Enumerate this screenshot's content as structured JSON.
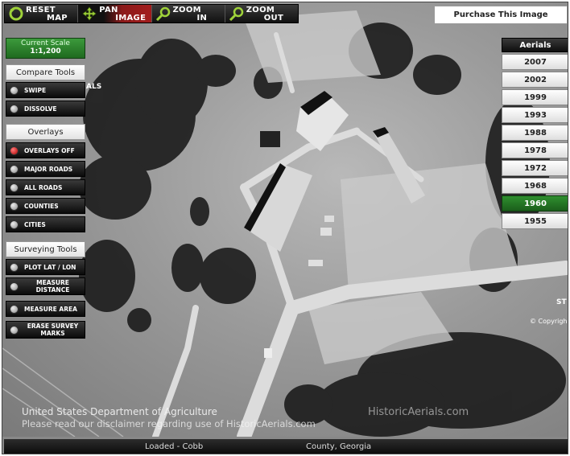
{
  "toolbar": {
    "reset": {
      "line1": "RESET",
      "line2": "MAP",
      "icon": "reset-arrow-icon"
    },
    "pan": {
      "line1": "PAN",
      "line2": "IMAGE",
      "icon": "pan-arrows-icon"
    },
    "zoom_in": {
      "line1": "ZOOM",
      "line2": "IN",
      "icon": "zoom-in-magnifier-icon"
    },
    "zoom_out": {
      "line1": "ZOOM",
      "line2": "OUT",
      "icon": "zoom-out-magnifier-icon"
    }
  },
  "purchase_label": "Purchase This Image",
  "scale": {
    "title": "Current Scale",
    "value": "1:1,200"
  },
  "compare": {
    "title": "Compare Tools",
    "items": [
      "SWIPE",
      "DISSOLVE"
    ]
  },
  "overlays": {
    "title": "Overlays",
    "items": [
      "OVERLAYS OFF",
      "MAJOR ROADS",
      "ALL ROADS",
      "COUNTIES",
      "CITIES"
    ]
  },
  "surveying": {
    "title": "Surveying Tools",
    "items": [
      "PLOT LAT / LON",
      "MEASURE DISTANCE",
      "MEASURE AREA",
      "ERASE SURVEY MARKS"
    ]
  },
  "aerials": {
    "title": "Aerials",
    "years": [
      "2007",
      "2002",
      "1999",
      "1993",
      "1988",
      "1978",
      "1972",
      "1968",
      "1960",
      "1955"
    ],
    "selected": "1960"
  },
  "map": {
    "agency": "United States Department of Agriculture",
    "disclaimer": "Please read our disclaimer regarding use of HistoricAerials.com",
    "watermark": "HistoricAerials.com",
    "copyright": "© Copyrigh",
    "edge_left": "ALS",
    "edge_right": "ST"
  },
  "status": {
    "loaded": "Loaded - Cobb",
    "county": "County, Georgia"
  },
  "colors": {
    "accent_green": "#1f6a1f",
    "selected_red": "#a31c1c"
  }
}
